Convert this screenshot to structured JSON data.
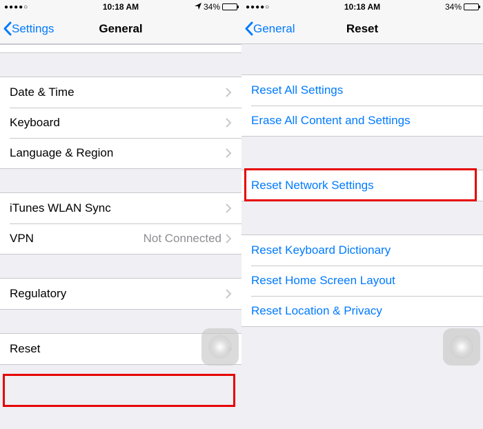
{
  "left": {
    "status": {
      "time": "10:18 AM",
      "battery": "34%",
      "location": true
    },
    "nav": {
      "back": "Settings",
      "title": "General"
    },
    "group1": [
      {
        "label": "Date & Time"
      },
      {
        "label": "Keyboard"
      },
      {
        "label": "Language & Region"
      }
    ],
    "group2": [
      {
        "label": "iTunes WLAN Sync"
      },
      {
        "label": "VPN",
        "detail": "Not Connected"
      }
    ],
    "group3": [
      {
        "label": "Regulatory"
      }
    ],
    "group4": [
      {
        "label": "Reset"
      }
    ]
  },
  "right": {
    "status": {
      "time": "10:18 AM",
      "battery": "34%",
      "location": false
    },
    "nav": {
      "back": "General",
      "title": "Reset"
    },
    "group1": [
      {
        "label": "Reset All Settings"
      },
      {
        "label": "Erase All Content and Settings"
      }
    ],
    "group2": [
      {
        "label": "Reset Network Settings"
      }
    ],
    "group3": [
      {
        "label": "Reset Keyboard Dictionary"
      },
      {
        "label": "Reset Home Screen Layout"
      },
      {
        "label": "Reset Location & Privacy"
      }
    ]
  }
}
